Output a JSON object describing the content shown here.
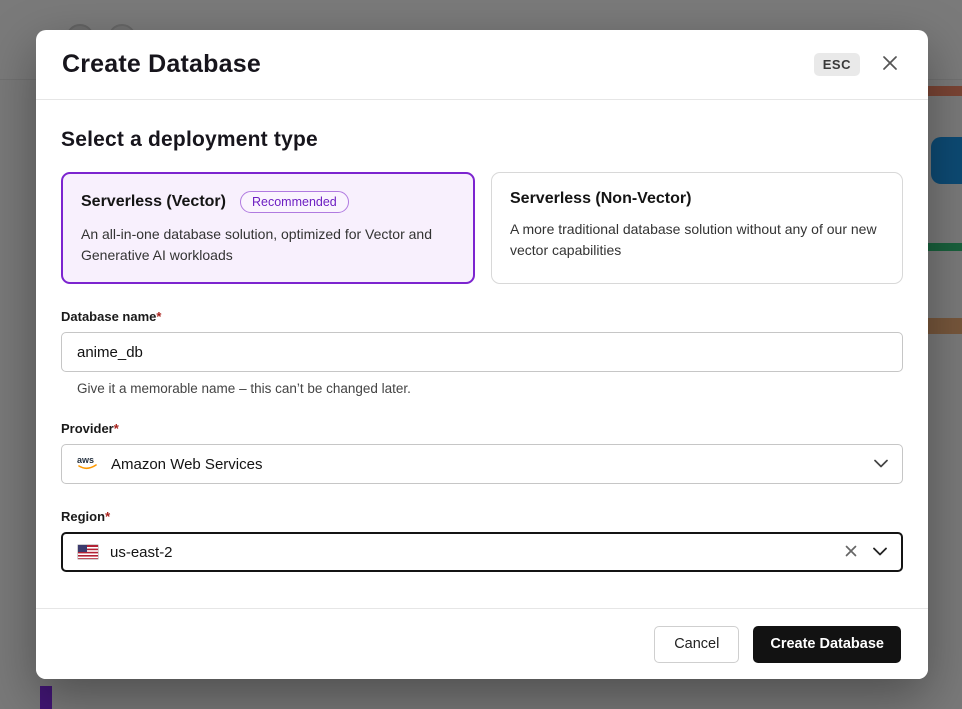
{
  "modal": {
    "title": "Create Database",
    "esc_label": "ESC",
    "section_title": "Select a deployment type",
    "deployment_options": [
      {
        "title": "Serverless (Vector)",
        "badge": "Recommended",
        "description": "An all-in-one database solution, optimized for Vector and Generative AI workloads",
        "selected": true
      },
      {
        "title": "Serverless (Non-Vector)",
        "description": "A more traditional database solution without any of our new vector capabilities",
        "selected": false
      }
    ],
    "fields": {
      "database_name": {
        "label": "Database name",
        "required_marker": "*",
        "value": "anime_db",
        "helper": "Give it a memorable name – this can’t be changed later."
      },
      "provider": {
        "label": "Provider",
        "required_marker": "*",
        "value": "Amazon Web Services",
        "icon": "aws-icon"
      },
      "region": {
        "label": "Region",
        "required_marker": "*",
        "value": "us-east-2",
        "icon": "us-flag-icon"
      }
    },
    "footer": {
      "cancel_label": "Cancel",
      "submit_label": "Create Database"
    },
    "colors": {
      "accent_purple": "#7c24cf",
      "selected_card_bg": "#f8f0fd",
      "submit_button_bg": "#121212",
      "focus_border": "#141414",
      "required_marker": "#a8201a"
    }
  }
}
